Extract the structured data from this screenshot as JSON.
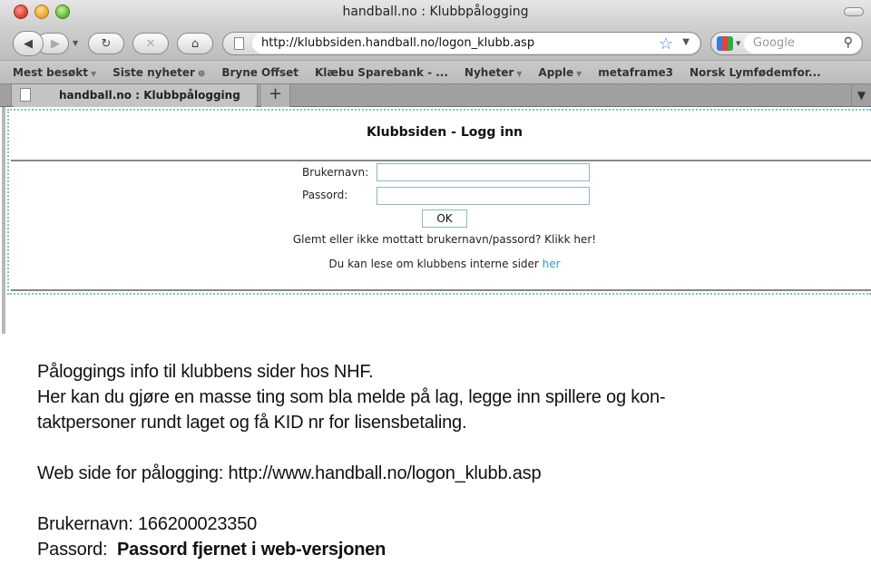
{
  "browser": {
    "window_title": "handball.no : Klubbpålogging",
    "url": "http://klubbsiden.handball.no/logon_klubb.asp",
    "search_placeholder": "Google",
    "bookmarks": [
      {
        "label": "Mest besøkt",
        "dropdown": true
      },
      {
        "label": "Siste nyheter",
        "rss": true
      },
      {
        "label": "Bryne Offset"
      },
      {
        "label": "Klæbu Sparebank - ..."
      },
      {
        "label": "Nyheter",
        "dropdown": true
      },
      {
        "label": "Apple",
        "dropdown": true
      },
      {
        "label": "metaframe3"
      },
      {
        "label": "Norsk Lymfødemfor..."
      }
    ],
    "tab_label": "handball.no : Klubbpålogging",
    "new_tab_label": "+",
    "icons": {
      "back": "◀",
      "forward": "▶",
      "reload": "↻",
      "stop": "✕",
      "home": "⌂",
      "bookmark_star": "☆",
      "dropdown": "▼",
      "search": "⚲",
      "rss": "⊛"
    }
  },
  "login_page": {
    "title": "Klubbsiden - Logg inn",
    "username_label": "Brukernavn:",
    "password_label": "Passord:",
    "username_value": "",
    "password_value": "",
    "ok_label": "OK",
    "forgot_text": "Glemt eller ikke mottatt brukernavn/passord? Klikk her!",
    "read_more_text": "Du kan lese om klubbens interne sider ",
    "read_more_link": "her",
    "link_color": "#2f9bd0"
  },
  "document": {
    "line1": "Påloggings info til klubbens sider hos NHF.",
    "line2": "Her kan du gjøre en masse ting som bla melde på lag, legge inn spillere og kon-",
    "line3": "taktpersoner rundt laget og få KID nr for lisensbetaling.",
    "web_label": "Web side for pålogging:  http://www.handball.no/logon_klubb.asp",
    "username_line": "Brukernavn: 166200023350",
    "password_prefix": "Passord:  ",
    "password_note": "Passord fjernet i web-versjonen"
  }
}
